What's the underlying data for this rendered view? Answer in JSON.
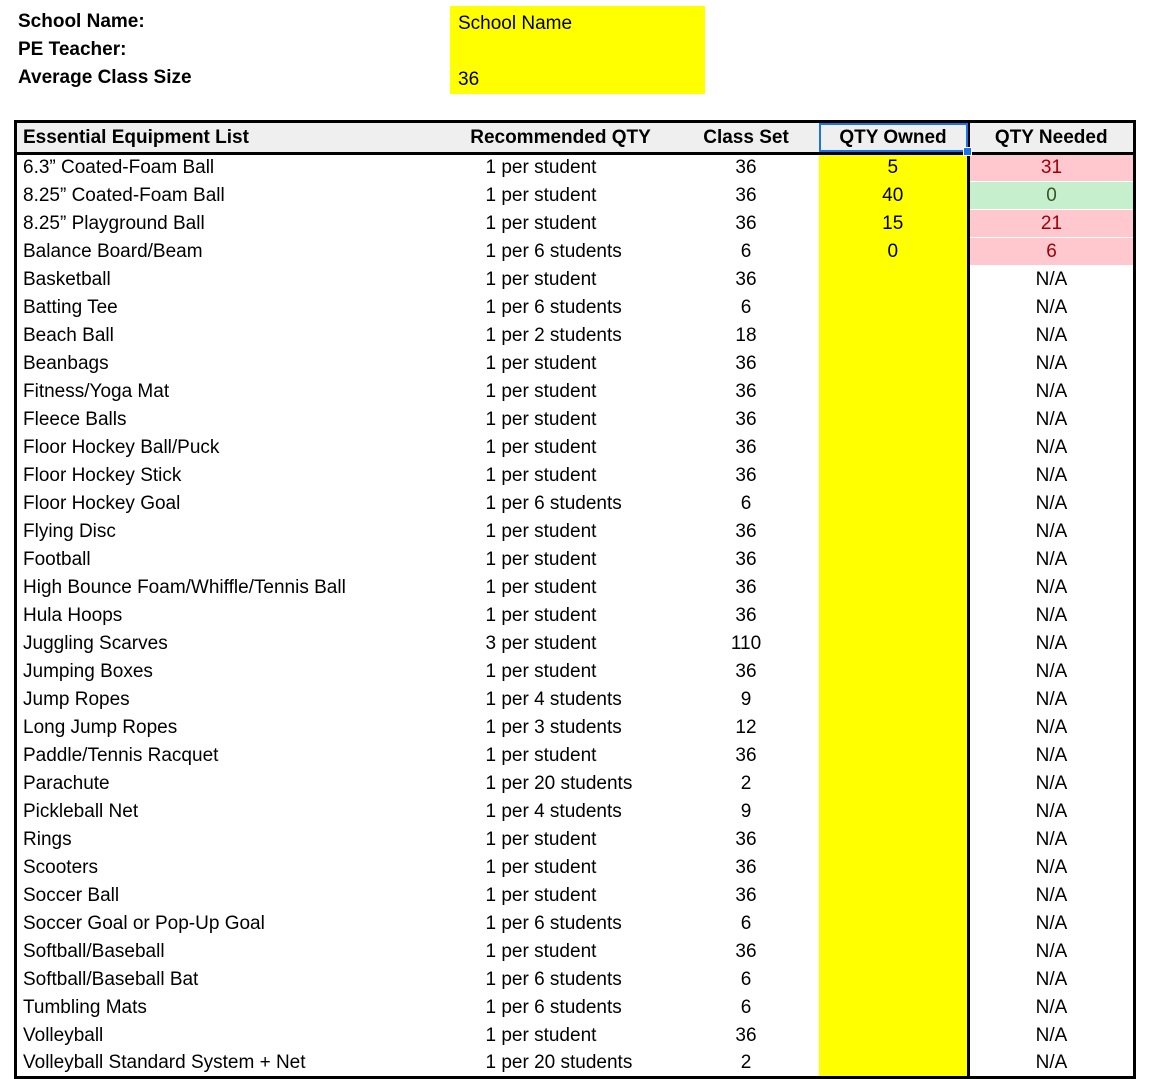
{
  "info": {
    "labels": [
      "School Name:",
      "PE Teacher:",
      "Average Class Size"
    ],
    "values": [
      "School Name",
      "",
      "36"
    ],
    "highlight_color": "#ffff00"
  },
  "table": {
    "headers": {
      "item": "Essential Equipment List",
      "recommended": "Recommended QTY",
      "class_set": "Class Set",
      "qty_owned": "QTY Owned",
      "qty_needed": "QTY Needed"
    },
    "selected_header": "QTY Owned",
    "selection_color": "#1a73e8",
    "owned_column_color": "#ffff00",
    "deficit_color": "#ffc7ce",
    "deficit_text_color": "#9c0006",
    "ok_color": "#c6efce",
    "ok_text_color": "#375623",
    "na_text": "N/A",
    "rows": [
      {
        "item": "6.3” Coated-Foam Ball",
        "recommended": "1 per student",
        "class_set": "36",
        "qty_owned": "5",
        "qty_needed": "31",
        "status": "deficit"
      },
      {
        "item": "8.25” Coated-Foam Ball",
        "recommended": "1 per student",
        "class_set": "36",
        "qty_owned": "40",
        "qty_needed": "0",
        "status": "ok"
      },
      {
        "item": "8.25” Playground Ball",
        "recommended": "1 per student",
        "class_set": "36",
        "qty_owned": "15",
        "qty_needed": "21",
        "status": "deficit"
      },
      {
        "item": "Balance Board/Beam",
        "recommended": "1 per 6 students",
        "class_set": "6",
        "qty_owned": "0",
        "qty_needed": "6",
        "status": "deficit"
      },
      {
        "item": "Basketball",
        "recommended": "1 per student",
        "class_set": "36",
        "qty_owned": "",
        "qty_needed": "N/A",
        "status": "none"
      },
      {
        "item": "Batting Tee",
        "recommended": "1 per 6 students",
        "class_set": "6",
        "qty_owned": "",
        "qty_needed": "N/A",
        "status": "none"
      },
      {
        "item": "Beach Ball",
        "recommended": "1 per 2 students",
        "class_set": "18",
        "qty_owned": "",
        "qty_needed": "N/A",
        "status": "none"
      },
      {
        "item": "Beanbags",
        "recommended": "1 per student",
        "class_set": "36",
        "qty_owned": "",
        "qty_needed": "N/A",
        "status": "none"
      },
      {
        "item": "Fitness/Yoga Mat",
        "recommended": "1 per student",
        "class_set": "36",
        "qty_owned": "",
        "qty_needed": "N/A",
        "status": "none"
      },
      {
        "item": "Fleece Balls",
        "recommended": "1 per student",
        "class_set": "36",
        "qty_owned": "",
        "qty_needed": "N/A",
        "status": "none"
      },
      {
        "item": "Floor Hockey Ball/Puck",
        "recommended": "1 per student",
        "class_set": "36",
        "qty_owned": "",
        "qty_needed": "N/A",
        "status": "none"
      },
      {
        "item": "Floor Hockey Stick",
        "recommended": "1 per student",
        "class_set": "36",
        "qty_owned": "",
        "qty_needed": "N/A",
        "status": "none"
      },
      {
        "item": "Floor Hockey Goal",
        "recommended": "1 per 6 students",
        "class_set": "6",
        "qty_owned": "",
        "qty_needed": "N/A",
        "status": "none"
      },
      {
        "item": "Flying Disc",
        "recommended": "1 per student",
        "class_set": "36",
        "qty_owned": "",
        "qty_needed": "N/A",
        "status": "none"
      },
      {
        "item": "Football",
        "recommended": "1 per student",
        "class_set": "36",
        "qty_owned": "",
        "qty_needed": "N/A",
        "status": "none"
      },
      {
        "item": "High Bounce Foam/Whiffle/Tennis Ball",
        "recommended": "1 per student",
        "class_set": "36",
        "qty_owned": "",
        "qty_needed": "N/A",
        "status": "none"
      },
      {
        "item": "Hula Hoops",
        "recommended": "1 per student",
        "class_set": "36",
        "qty_owned": "",
        "qty_needed": "N/A",
        "status": "none"
      },
      {
        "item": "Juggling Scarves",
        "recommended": "3 per student",
        "class_set": "110",
        "qty_owned": "",
        "qty_needed": "N/A",
        "status": "none"
      },
      {
        "item": "Jumping Boxes",
        "recommended": "1 per student",
        "class_set": "36",
        "qty_owned": "",
        "qty_needed": "N/A",
        "status": "none"
      },
      {
        "item": "Jump Ropes",
        "recommended": "1 per 4 students",
        "class_set": "9",
        "qty_owned": "",
        "qty_needed": "N/A",
        "status": "none"
      },
      {
        "item": "Long Jump Ropes",
        "recommended": "1 per 3 students",
        "class_set": "12",
        "qty_owned": "",
        "qty_needed": "N/A",
        "status": "none"
      },
      {
        "item": "Paddle/Tennis Racquet",
        "recommended": "1 per student",
        "class_set": "36",
        "qty_owned": "",
        "qty_needed": "N/A",
        "status": "none"
      },
      {
        "item": "Parachute",
        "recommended": "1 per 20 students",
        "class_set": "2",
        "qty_owned": "",
        "qty_needed": "N/A",
        "status": "none"
      },
      {
        "item": "Pickleball Net",
        "recommended": "1 per 4 students",
        "class_set": "9",
        "qty_owned": "",
        "qty_needed": "N/A",
        "status": "none"
      },
      {
        "item": "Rings",
        "recommended": "1 per student",
        "class_set": "36",
        "qty_owned": "",
        "qty_needed": "N/A",
        "status": "none"
      },
      {
        "item": "Scooters",
        "recommended": "1 per student",
        "class_set": "36",
        "qty_owned": "",
        "qty_needed": "N/A",
        "status": "none"
      },
      {
        "item": "Soccer Ball",
        "recommended": "1 per student",
        "class_set": "36",
        "qty_owned": "",
        "qty_needed": "N/A",
        "status": "none"
      },
      {
        "item": "Soccer Goal or Pop-Up Goal",
        "recommended": "1 per 6 students",
        "class_set": "6",
        "qty_owned": "",
        "qty_needed": "N/A",
        "status": "none"
      },
      {
        "item": "Softball/Baseball",
        "recommended": "1 per student",
        "class_set": "36",
        "qty_owned": "",
        "qty_needed": "N/A",
        "status": "none"
      },
      {
        "item": "Softball/Baseball Bat",
        "recommended": "1 per 6 students",
        "class_set": "6",
        "qty_owned": "",
        "qty_needed": "N/A",
        "status": "none"
      },
      {
        "item": "Tumbling Mats",
        "recommended": "1 per 6 students",
        "class_set": "6",
        "qty_owned": "",
        "qty_needed": "N/A",
        "status": "none"
      },
      {
        "item": "Volleyball",
        "recommended": "1 per student",
        "class_set": "36",
        "qty_owned": "",
        "qty_needed": "N/A",
        "status": "none"
      },
      {
        "item": "Volleyball Standard System + Net",
        "recommended": "1 per 20 students",
        "class_set": "2",
        "qty_owned": "",
        "qty_needed": "N/A",
        "status": "none"
      }
    ]
  }
}
